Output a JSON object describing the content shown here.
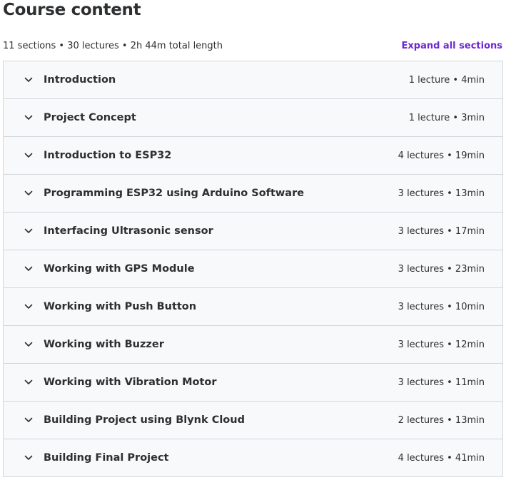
{
  "header": {
    "title": "Course content",
    "summary": "11 sections • 30 lectures • 2h 44m total length",
    "expand_label": "Expand all sections"
  },
  "icons": {
    "chevron": "chevron-down-icon"
  },
  "colors": {
    "accent": "#6d28d2",
    "section_bg": "#f7f9fa",
    "border": "#d1d7dc",
    "text": "#2d2f31"
  },
  "sections": [
    {
      "title": "Introduction",
      "meta": "1 lecture • 4min"
    },
    {
      "title": "Project Concept",
      "meta": "1 lecture • 3min"
    },
    {
      "title": "Introduction to ESP32",
      "meta": "4 lectures • 19min"
    },
    {
      "title": "Programming ESP32 using Arduino Software",
      "meta": "3 lectures • 13min"
    },
    {
      "title": "Interfacing Ultrasonic sensor",
      "meta": "3 lectures • 17min"
    },
    {
      "title": "Working with GPS Module",
      "meta": "3 lectures • 23min"
    },
    {
      "title": "Working with Push Button",
      "meta": "3 lectures • 10min"
    },
    {
      "title": "Working with Buzzer",
      "meta": "3 lectures • 12min"
    },
    {
      "title": "Working with Vibration Motor",
      "meta": "3 lectures • 11min"
    },
    {
      "title": "Building Project using Blynk Cloud",
      "meta": "2 lectures • 13min"
    },
    {
      "title": "Building Final Project",
      "meta": "4 lectures • 41min"
    }
  ]
}
